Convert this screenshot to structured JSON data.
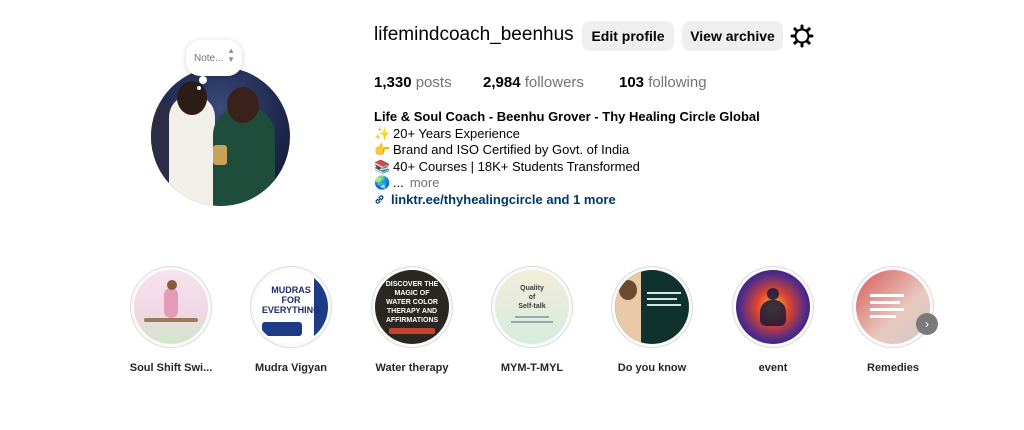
{
  "profile": {
    "username": "lifemindcoach_beenhus",
    "edit_label": "Edit profile",
    "archive_label": "View archive",
    "note_label": "Note...",
    "posts_count": "1,330",
    "posts_label": "posts",
    "followers_count": "2,984",
    "followers_label": "followers",
    "following_count": "103",
    "following_label": "following"
  },
  "bio": {
    "name": "Life & Soul Coach - Beenhu Grover - Thy Healing Circle Global",
    "line1": "20+ Years Experience",
    "line2": "Brand and ISO Certified by Govt. of India",
    "line3": "40+ Courses | 18K+ Students Transformed",
    "line4_prefix": "...",
    "line4_more": "more",
    "link": "linktr.ee/thyhealingcircle and 1 more"
  },
  "highlights": [
    {
      "label": "Soul Shift Swi..."
    },
    {
      "label": "Mudra Vigyan",
      "thumb": [
        "MUDRAS",
        "FOR",
        "EVERYTHING"
      ]
    },
    {
      "label": "Water therapy",
      "thumb": [
        "DISCOVER THE",
        "MAGIC OF",
        "WATER COLOR",
        "THERAPY AND",
        "AFFIRMATIONS"
      ]
    },
    {
      "label": "MYM-T-MYL",
      "thumb": [
        "Quality",
        "of",
        "Self-talk"
      ]
    },
    {
      "label": "Do you know"
    },
    {
      "label": "event"
    },
    {
      "label": "Remedies"
    }
  ],
  "icons": {
    "settings": "gear-icon",
    "link": "link-icon",
    "next": "chevron-right-icon"
  },
  "colors": {
    "button_bg": "#efefef",
    "link": "#00376b",
    "muted": "#737373"
  }
}
